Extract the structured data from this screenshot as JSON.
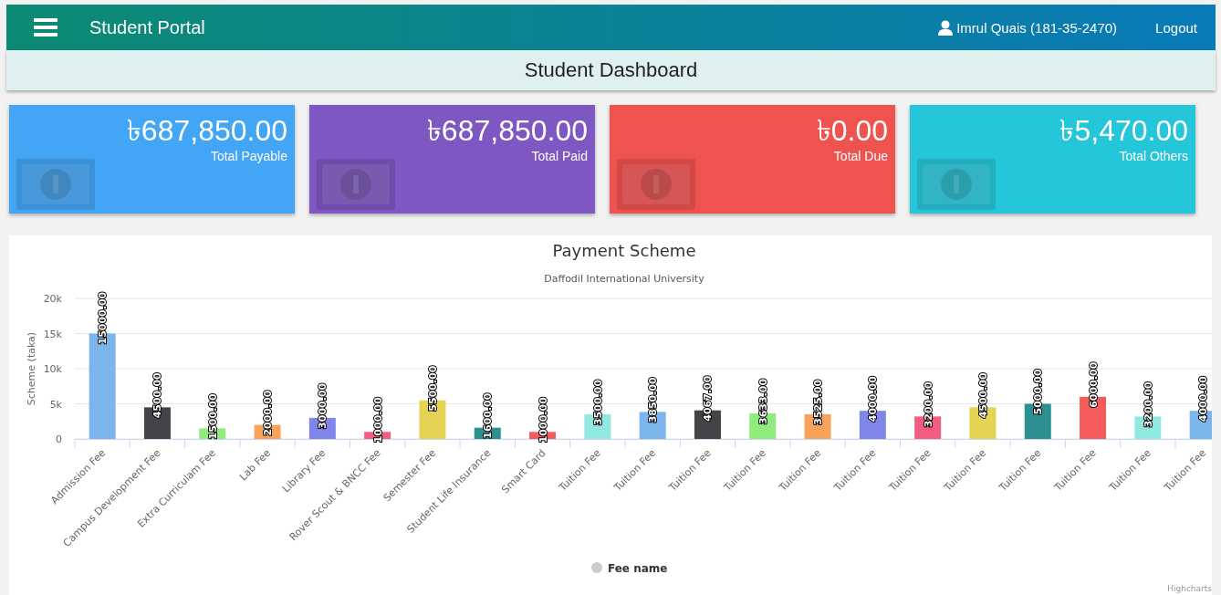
{
  "header": {
    "title": "Student Portal",
    "user": "Imrul Quais (181-35-2470)",
    "logout": "Logout"
  },
  "page_title": "Student Dashboard",
  "cards": [
    {
      "amount": "৳687,850.00",
      "label": "Total Payable",
      "color": "#42a5f5"
    },
    {
      "amount": "৳687,850.00",
      "label": "Total Paid",
      "color": "#7e57c2"
    },
    {
      "amount": "৳0.00",
      "label": "Total Due",
      "color": "#ef5350"
    },
    {
      "amount": "৳5,470.00",
      "label": "Total Others",
      "color": "#26c6da"
    }
  ],
  "chart": {
    "subtitle": "Daffodil International University",
    "credits": "Highcharts",
    "chart_data": {
      "type": "bar",
      "orientation": "vertical",
      "title": "Payment Scheme",
      "ylabel": "Scheme (taka)",
      "categories": [
        "Admission Fee",
        "Campus Development Fee",
        "Extra Curriculam Fee",
        "Lab Fee",
        "Library Fee",
        "Rover Scout & BNCC Fee",
        "Semester Fee",
        "Student Life Insurance",
        "Smart Card",
        "Tuition Fee",
        "Tuition Fee",
        "Tuition Fee",
        "Tuition Fee",
        "Tuition Fee",
        "Tuition Fee",
        "Tuition Fee",
        "Tuition Fee",
        "Tuition Fee",
        "Tuition Fee",
        "Tuition Fee",
        "Tuition Fee"
      ],
      "series": [
        {
          "name": "Fee name",
          "color": "#cccccc",
          "values": [
            15000,
            4500,
            1500,
            2000,
            3000,
            1000,
            5500,
            1600,
            1000,
            3500,
            3850,
            4067,
            3633,
            3525,
            4000,
            3200,
            4500,
            5000,
            6000,
            3200,
            4000
          ],
          "colors": [
            "#7cb5ec",
            "#434348",
            "#90ed7d",
            "#f7a35c",
            "#8085e9",
            "#f15c80",
            "#e4d354",
            "#2b908f",
            "#f45b5b",
            "#91e8e1",
            "#7cb5ec",
            "#434348",
            "#90ed7d",
            "#f7a35c",
            "#8085e9",
            "#f15c80",
            "#e4d354",
            "#2b908f",
            "#f45b5b",
            "#91e8e1",
            "#7cb5ec"
          ]
        }
      ],
      "value_labels": [
        "15000.00",
        "4500.00",
        "1500.00",
        "2000.00",
        "3000.00",
        "1000.00",
        "5500.00",
        "1600.00",
        "1000.00",
        "3500.00",
        "3850.00",
        "4067.00",
        "3633.00",
        "3525.00",
        "4000.00",
        "3200.00",
        "4500.00",
        "5000.00",
        "6000.00",
        "3200.00",
        "4000.00"
      ],
      "grid": true,
      "ylim": [
        0,
        20000
      ],
      "yticks": [
        {
          "value": 0,
          "label": "0"
        },
        {
          "value": 5000,
          "label": "5k"
        },
        {
          "value": 10000,
          "label": "10k"
        },
        {
          "value": 15000,
          "label": "15k"
        },
        {
          "value": 20000,
          "label": "20k"
        }
      ]
    }
  }
}
